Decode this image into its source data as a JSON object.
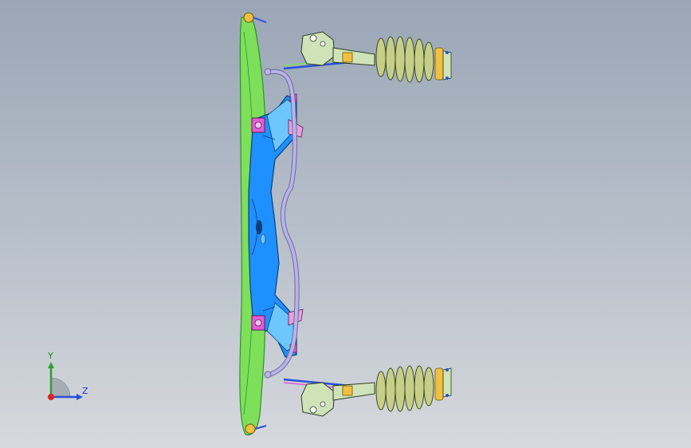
{
  "viewport": {
    "background_top": "#9aa6b6",
    "background_bottom": "#d6d9dd"
  },
  "model": {
    "colors": {
      "subframe": "#1e90ff",
      "subframe_light": "#6ec6ff",
      "control_arm": "#7ee05a",
      "control_arm_dark": "#2f8f2f",
      "stabilizer_bar": "#b8b4ea",
      "stabilizer_outline": "#6d6a9a",
      "bracket_pink": "#e35bd6",
      "bracket_pink_light": "#e7a0da",
      "spring": "#c5cf88",
      "spring_outline": "#3f4a22",
      "spring_mount": "#f0c040",
      "strut_body": "#cfe3b8"
    }
  },
  "triad": {
    "y_label": "Y",
    "z_label": "Z",
    "y_color": "#2ea02e",
    "z_color": "#2a4fd8",
    "x_color": "#e02020"
  }
}
